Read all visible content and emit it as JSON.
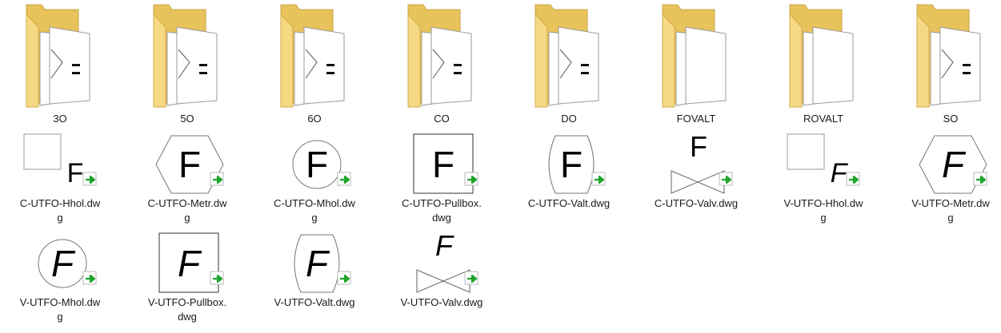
{
  "folders": [
    {
      "name": "3O",
      "preview": "hexagon-partial"
    },
    {
      "name": "5O",
      "preview": "hexagon-partial"
    },
    {
      "name": "6O",
      "preview": "hexagon-partial"
    },
    {
      "name": "CO",
      "preview": "circle-partial"
    },
    {
      "name": "DO",
      "preview": "rounded-partial"
    },
    {
      "name": "FOVALT",
      "preview": "blank"
    },
    {
      "name": "ROVALT",
      "preview": "blank"
    },
    {
      "name": "SO",
      "preview": "square-partial"
    }
  ],
  "files": [
    {
      "name": "C-UTFO-Hhol.dw\ng",
      "letter": "F",
      "shape": "hhol",
      "italic": false
    },
    {
      "name": "C-UTFO-Metr.dw\ng",
      "letter": "F",
      "shape": "hexagon",
      "italic": false
    },
    {
      "name": "C-UTFO-Mhol.dw\ng",
      "letter": "F",
      "shape": "circle",
      "italic": false
    },
    {
      "name": "C-UTFO-Pullbox.\ndwg",
      "letter": "F",
      "shape": "square",
      "italic": false
    },
    {
      "name": "C-UTFO-Valt.dwg",
      "letter": "F",
      "shape": "valt",
      "italic": false
    },
    {
      "name": "C-UTFO-Valv.dwg",
      "letter": "F",
      "shape": "valve",
      "italic": false
    },
    {
      "name": "V-UTFO-Hhol.dw\ng",
      "letter": "F",
      "shape": "hhol",
      "italic": true
    },
    {
      "name": "V-UTFO-Metr.dw\ng",
      "letter": "F",
      "shape": "hexagon",
      "italic": true
    },
    {
      "name": "V-UTFO-Mhol.dw\ng",
      "letter": "F",
      "shape": "circle",
      "italic": true
    },
    {
      "name": "V-UTFO-Pullbox.\ndwg",
      "letter": "F",
      "shape": "square",
      "italic": true
    },
    {
      "name": "V-UTFO-Valt.dwg",
      "letter": "F",
      "shape": "valt",
      "italic": true
    },
    {
      "name": "V-UTFO-Valv.dwg",
      "letter": "F",
      "shape": "valve",
      "italic": true
    }
  ],
  "colors": {
    "folder_back": "#e8c25a",
    "folder_front": "#f7d983",
    "shortcut_arrow": "#1fa52b",
    "label_text": "#1a1a1a"
  }
}
